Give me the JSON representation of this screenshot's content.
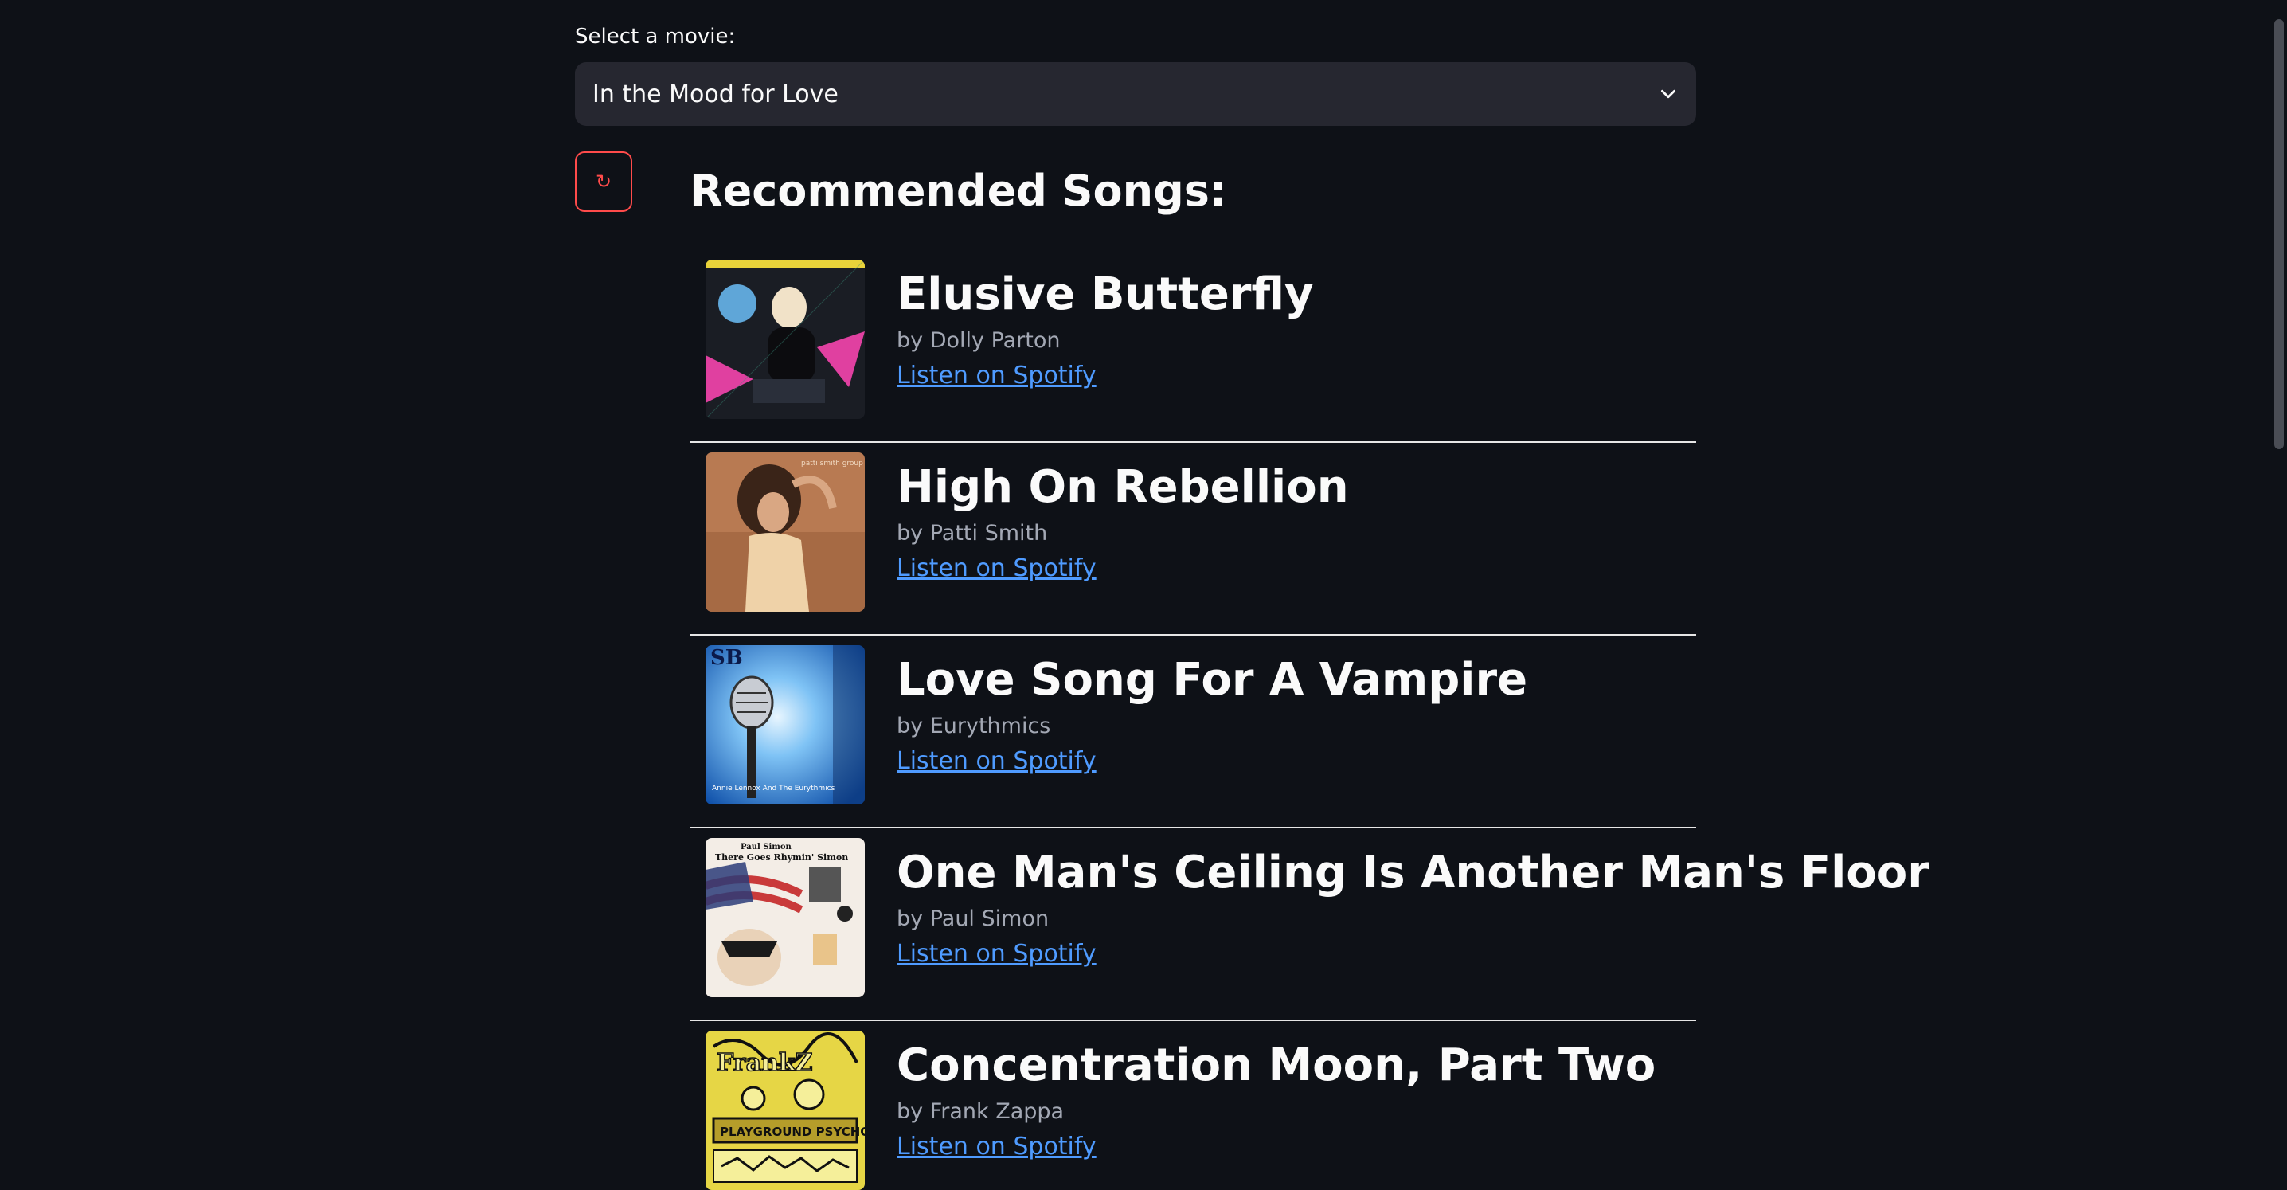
{
  "movie_select": {
    "label": "Select a movie:",
    "value": "In the Mood for Love"
  },
  "refresh_button": {
    "icon": "refresh-icon",
    "glyph": "↻",
    "color": "#ff4b4b"
  },
  "heading": "Recommended Songs:",
  "link_color": "#4f9bff",
  "songs": [
    {
      "title": "Elusive Butterfly",
      "artist": "by Dolly Parton",
      "link": "Listen on Spotify",
      "cover_palette": [
        "#1a1d24",
        "#e040a0",
        "#c9c2b6",
        "#2a2f3a"
      ]
    },
    {
      "title": "High On Rebellion",
      "artist": "by Patti Smith",
      "link": "Listen on Spotify",
      "cover_palette": [
        "#b87a52",
        "#d49b6c",
        "#3a2418",
        "#efd2a8"
      ]
    },
    {
      "title": "Love Song For A Vampire",
      "artist": "by Eurythmics",
      "link": "Listen on Spotify",
      "cover_palette": [
        "#0d4ea8",
        "#7fc3f5",
        "#ffffff",
        "#1a1a1a"
      ]
    },
    {
      "title": "One Man's Ceiling Is Another Man's Floor",
      "artist": "by Paul Simon",
      "link": "Listen on Spotify",
      "cover_palette": [
        "#f3ede6",
        "#c93a3a",
        "#2a3b78",
        "#e9c48a"
      ]
    },
    {
      "title": "Concentration Moon, Part Two",
      "artist": "by Frank Zappa",
      "link": "Listen on Spotify",
      "cover_palette": [
        "#e6d645",
        "#111111",
        "#f5ef9a",
        "#b59d2a"
      ]
    }
  ]
}
